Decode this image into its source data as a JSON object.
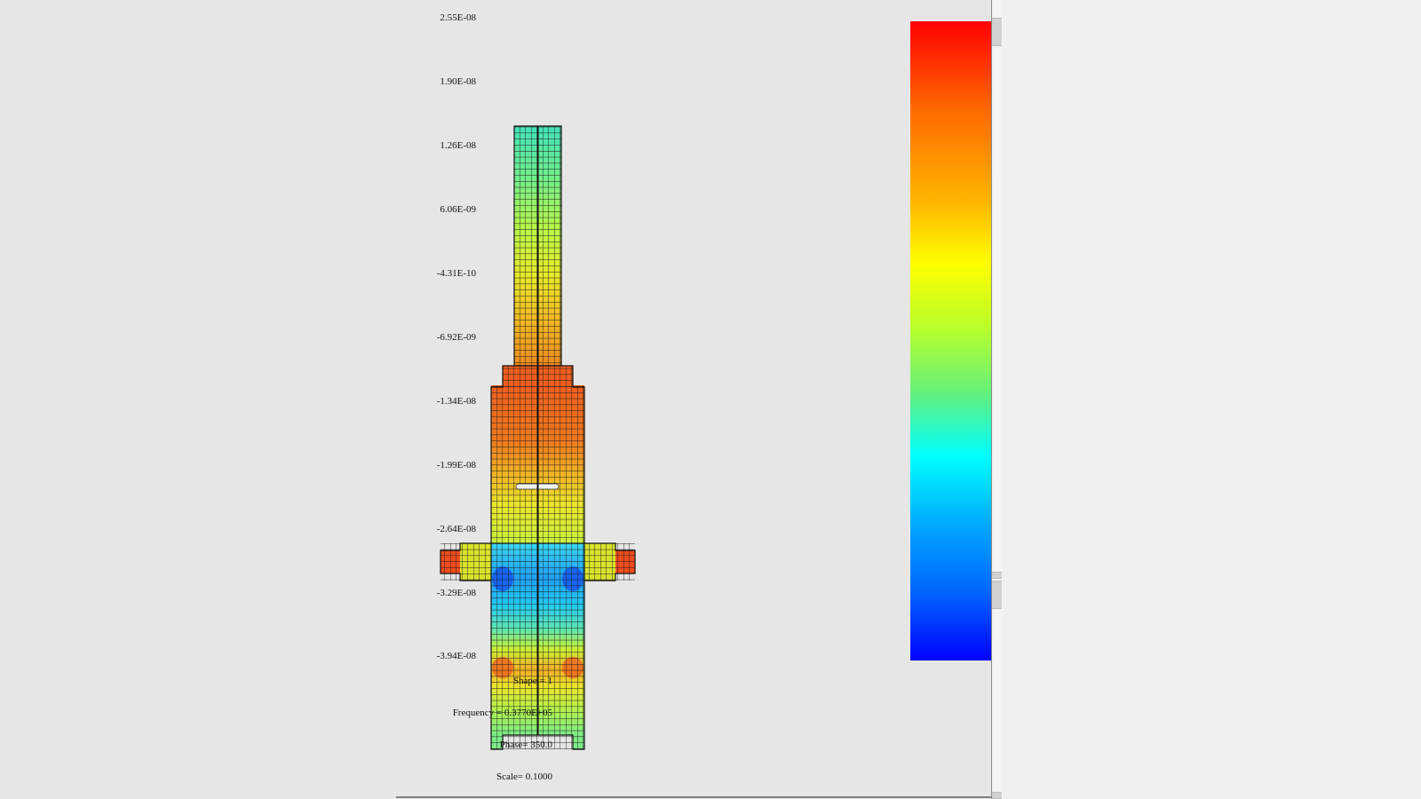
{
  "colorbar": {
    "ticks": [
      "2.55E-08",
      "1.90E-08",
      "1.26E-08",
      "6.06E-09",
      "-4.31E-10",
      "-6.92E-09",
      "-1.34E-08",
      "-1.99E-08",
      "-2.64E-08",
      "-3.29E-08",
      "-3.94E-08"
    ],
    "colors": {
      "max": "#ff0000",
      "mid": "#ffff00",
      "cyan": "#00ffff",
      "min": "#0000ff"
    }
  },
  "info": {
    "shape": "Shape =   1",
    "frequency": "Frequency = 0.3770E+05",
    "phase": "Phase=  350.0",
    "scale": "Scale= 0.1000"
  }
}
